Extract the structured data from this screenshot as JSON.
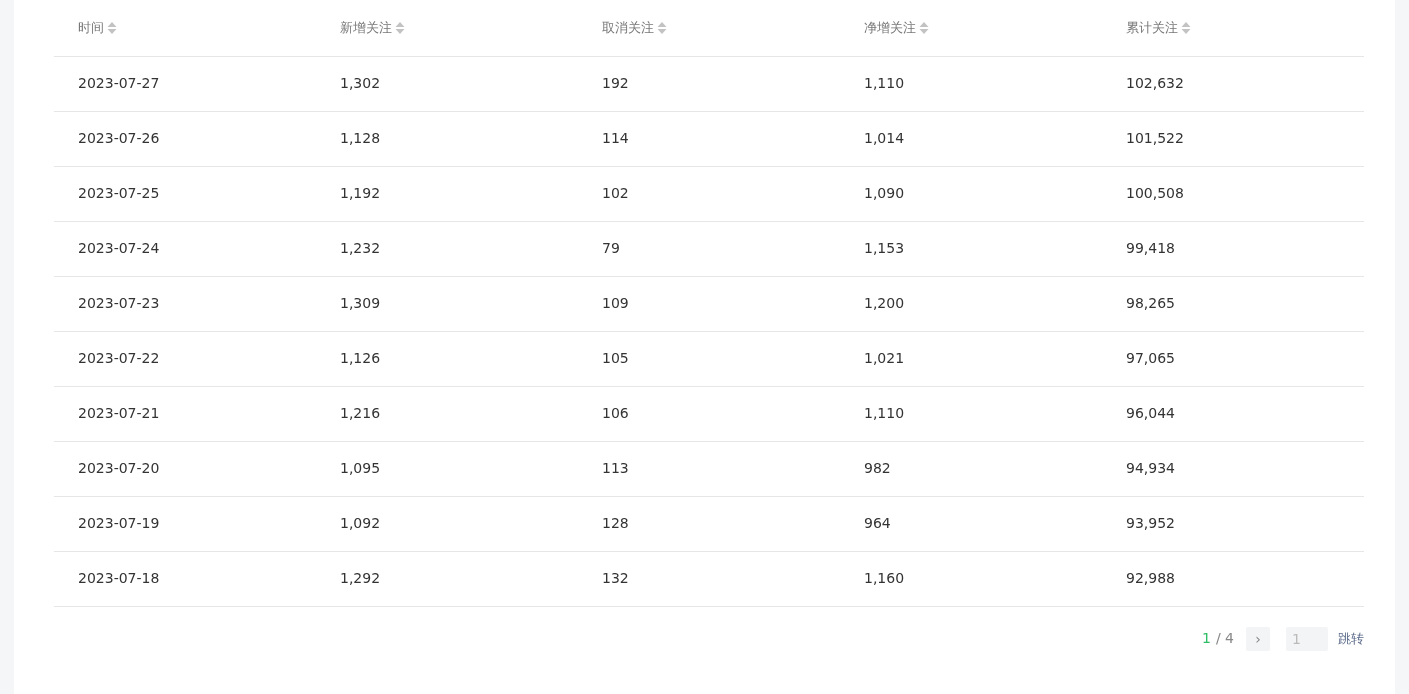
{
  "table": {
    "columns": [
      "时间",
      "新增关注",
      "取消关注",
      "净增关注",
      "累计关注"
    ],
    "rows": [
      [
        "2023-07-27",
        "1,302",
        "192",
        "1,110",
        "102,632"
      ],
      [
        "2023-07-26",
        "1,128",
        "114",
        "1,014",
        "101,522"
      ],
      [
        "2023-07-25",
        "1,192",
        "102",
        "1,090",
        "100,508"
      ],
      [
        "2023-07-24",
        "1,232",
        "79",
        "1,153",
        "99,418"
      ],
      [
        "2023-07-23",
        "1,309",
        "109",
        "1,200",
        "98,265"
      ],
      [
        "2023-07-22",
        "1,126",
        "105",
        "1,021",
        "97,065"
      ],
      [
        "2023-07-21",
        "1,216",
        "106",
        "1,110",
        "96,044"
      ],
      [
        "2023-07-20",
        "1,095",
        "113",
        "982",
        "94,934"
      ],
      [
        "2023-07-19",
        "1,092",
        "128",
        "964",
        "93,952"
      ],
      [
        "2023-07-18",
        "1,292",
        "132",
        "1,160",
        "92,988"
      ]
    ]
  },
  "pagination": {
    "current": "1",
    "total": "/ 4",
    "next": "›",
    "page_input": {
      "placeholder": "1"
    },
    "jump": "跳转"
  }
}
